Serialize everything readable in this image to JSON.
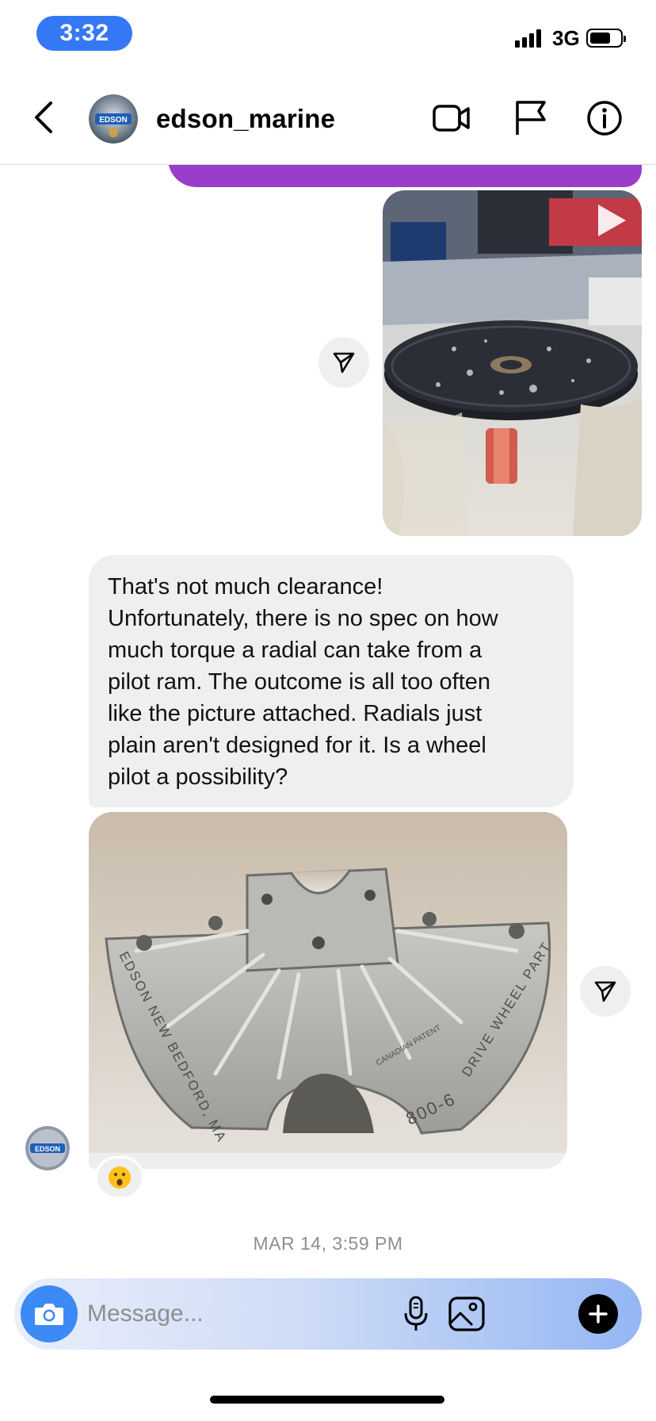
{
  "status_bar": {
    "time": "3:32",
    "network": "3G"
  },
  "header": {
    "username": "edson_marine",
    "icons": [
      "back-chevron-icon",
      "video-call-icon",
      "flag-icon",
      "info-icon"
    ]
  },
  "messages": [
    {
      "type": "image",
      "direction": "sent",
      "description_icon": "play-icon"
    },
    {
      "type": "text",
      "direction": "received",
      "lines": [
        "That's not much clearance!",
        "Unfortunately, there is no spec on how",
        "much torque a radial can take from a",
        "pilot ram. The outcome is all too often",
        "like the picture attached. Radials just",
        "plain aren't designed for it. Is a wheel",
        "pilot a possibility?"
      ]
    },
    {
      "type": "image",
      "direction": "received",
      "reaction": "😮"
    }
  ],
  "photo_text": {
    "brand": "EDSON",
    "arc_left": "EDSON NEW BEDFORD, MA",
    "arc_right": "DRIVE WHEEL PART",
    "part_no": "800-6",
    "patent": "CANADIAN PATENT"
  },
  "timestamp": "MAR 14, 3:59 PM",
  "composer": {
    "placeholder": "Message..."
  },
  "colors": {
    "accent": "#3478f6",
    "sent_bubble": "#9a3dc9",
    "received_bubble": "#efefef"
  }
}
